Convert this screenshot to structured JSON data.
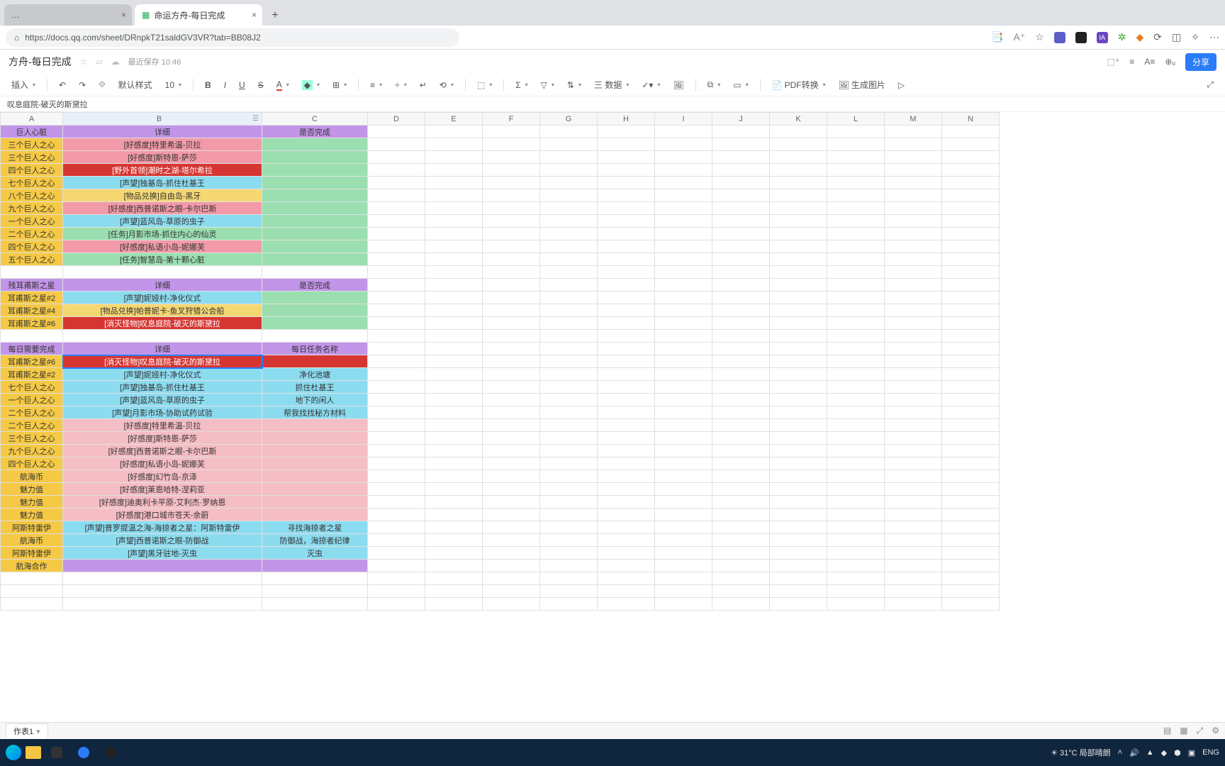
{
  "tabs": {
    "inactive": "…",
    "active": "命运方舟-每日完成"
  },
  "url": "https://docs.qq.com/sheet/DRnpkT21saldGV3VR?tab=BB08J2",
  "doc_title": "方舟-每日完成",
  "save_meta": "最近保存 10:46",
  "share": "分享",
  "toolbar": {
    "insert": "插入",
    "undo": "↶",
    "redo": "↷",
    "paint": "⟐",
    "clear": "默认样式",
    "fontsize": "10",
    "pdf": "PDF转换",
    "genimg": "生成图片"
  },
  "formula": "叹息庭院-破灭的斯黛拉",
  "cols": [
    "A",
    "B",
    "C",
    "D",
    "E",
    "F",
    "G",
    "H",
    "I",
    "J",
    "K",
    "L",
    "M",
    "N"
  ],
  "sheet_tab": "作表1",
  "weather": "31°C  局部晴朗",
  "lang": "ENG",
  "chart_data": null,
  "rows": [
    {
      "a": "巨人心脏",
      "b": "详细",
      "c": "是否完成",
      "cls": [
        "c-purple",
        "c-purple",
        "c-purple"
      ]
    },
    {
      "a": "三个巨人之心",
      "b": "[好感度]特里希温-贝拉",
      "c": "",
      "cls": [
        "c-yellow2",
        "c-pink",
        "c-green"
      ]
    },
    {
      "a": "三个巨人之心",
      "b": "[好感度]斯特恩-萨莎",
      "c": "",
      "cls": [
        "c-yellow2",
        "c-pink",
        "c-green"
      ]
    },
    {
      "a": "四个巨人之心",
      "b": "[野外首领]潮时之湖-塔尔希拉",
      "c": "",
      "cls": [
        "c-yellow2",
        "c-red",
        "c-green"
      ]
    },
    {
      "a": "七个巨人之心",
      "b": "[声望]独基岛-抓住杜基王",
      "c": "",
      "cls": [
        "c-yellow2",
        "c-dblue",
        "c-green"
      ]
    },
    {
      "a": "八个巨人之心",
      "b": "[物品兑换]自由岛-黑牙",
      "c": "",
      "cls": [
        "c-yellow2",
        "c-yellow",
        "c-green"
      ]
    },
    {
      "a": "九个巨人之心",
      "b": "[好感度]西普诺斯之眼-卡尔巴斯",
      "c": "",
      "cls": [
        "c-yellow2",
        "c-pink",
        "c-green"
      ]
    },
    {
      "a": "一个巨人之心",
      "b": "[声望]蓝风岛-草原的虫子",
      "c": "",
      "cls": [
        "c-yellow2",
        "c-dblue",
        "c-green"
      ]
    },
    {
      "a": "二个巨人之心",
      "b": "[任务]月影市场-抓住内心的仙灵",
      "c": "",
      "cls": [
        "c-yellow2",
        "c-green",
        "c-green"
      ]
    },
    {
      "a": "四个巨人之心",
      "b": "[好感度]私语小岛-妮娜芙",
      "c": "",
      "cls": [
        "c-yellow2",
        "c-pink",
        "c-green"
      ]
    },
    {
      "a": "五个巨人之心",
      "b": "[任务]智慧岛-第十颗心脏",
      "c": "",
      "cls": [
        "c-yellow2",
        "c-green",
        "c-green"
      ]
    },
    {
      "a": "",
      "b": "",
      "c": "",
      "cls": [
        "",
        "",
        ""
      ]
    },
    {
      "a": "残耳甫斯之星",
      "b": "详细",
      "c": "是否完成",
      "cls": [
        "c-purple",
        "c-purple",
        "c-purple"
      ]
    },
    {
      "a": "耳甫斯之星#2",
      "b": "[声望]妮娅村-净化仪式",
      "c": "",
      "cls": [
        "c-yellow2",
        "c-dblue",
        "c-green"
      ]
    },
    {
      "a": "耳甫斯之星#4",
      "b": "[物品兑换]帕普妮卡-鱼叉狩猎公会船",
      "c": "",
      "cls": [
        "c-yellow2",
        "c-yellow",
        "c-green"
      ]
    },
    {
      "a": "耳甫斯之星#6",
      "b": "[消灭怪物]叹息庭院-破灭的斯黛拉",
      "c": "",
      "cls": [
        "c-yellow2",
        "c-red",
        "c-green"
      ]
    },
    {
      "a": "",
      "b": "",
      "c": "",
      "cls": [
        "",
        "",
        ""
      ]
    },
    {
      "a": "每日需要完成",
      "b": "详细",
      "c": "每日任务名称",
      "cls": [
        "c-purple",
        "c-purple",
        "c-purple"
      ]
    },
    {
      "a": "耳甫斯之星#6",
      "b": "[消灭怪物]叹息庭院-破灭的斯黛拉",
      "c": "",
      "cls": [
        "c-yellow2",
        "c-red",
        "c-red"
      ],
      "sel": true
    },
    {
      "a": "耳甫斯之星#2",
      "b": "[声望]妮娅村-净化仪式",
      "c": "净化池塘",
      "cls": [
        "c-yellow2",
        "c-dblue",
        "c-dblue"
      ]
    },
    {
      "a": "七个巨人之心",
      "b": "[声望]独基岛-抓住杜基王",
      "c": "抓住杜基王",
      "cls": [
        "c-yellow2",
        "c-dblue",
        "c-dblue"
      ]
    },
    {
      "a": "一个巨人之心",
      "b": "[声望]蓝风岛-草原的虫子",
      "c": "地下的闲人",
      "cls": [
        "c-yellow2",
        "c-dblue",
        "c-dblue"
      ]
    },
    {
      "a": "二个巨人之心",
      "b": "[声望]月影市场-协助试药试验",
      "c": "帮我找找秘方材料",
      "cls": [
        "c-yellow2",
        "c-dblue",
        "c-dblue"
      ]
    },
    {
      "a": "二个巨人之心",
      "b": "[好感度]特里希温-贝拉",
      "c": "",
      "cls": [
        "c-yellow2",
        "c-lpink",
        "c-lpink"
      ]
    },
    {
      "a": "三个巨人之心",
      "b": "[好感度]斯特恩-萨莎",
      "c": "",
      "cls": [
        "c-yellow2",
        "c-lpink",
        "c-lpink"
      ]
    },
    {
      "a": "九个巨人之心",
      "b": "[好感度]西普诺斯之眼-卡尔巴斯",
      "c": "",
      "cls": [
        "c-yellow2",
        "c-lpink",
        "c-lpink"
      ]
    },
    {
      "a": "四个巨人之心",
      "b": "[好感度]私语小岛-妮娜芙",
      "c": "",
      "cls": [
        "c-yellow2",
        "c-lpink",
        "c-lpink"
      ]
    },
    {
      "a": "航海币",
      "b": "[好感度]幻竹岛-京泽",
      "c": "",
      "cls": [
        "c-yellow2",
        "c-lpink",
        "c-lpink"
      ]
    },
    {
      "a": "魅力值",
      "b": "[好感度]莱恩哈特-涅莉亚",
      "c": "",
      "cls": [
        "c-yellow2",
        "c-lpink",
        "c-lpink"
      ]
    },
    {
      "a": "魅力值",
      "b": "[好感度]迪奥利卡平原-艾利杰·罗纳恩",
      "c": "",
      "cls": [
        "c-yellow2",
        "c-lpink",
        "c-lpink"
      ]
    },
    {
      "a": "魅力值",
      "b": "[好感度]港口城市苍天-余蔚",
      "c": "",
      "cls": [
        "c-yellow2",
        "c-lpink",
        "c-lpink"
      ]
    },
    {
      "a": "阿斯特雷伊",
      "b": "[声望]普罗提温之海-海掠者之星：阿斯特雷伊",
      "c": "寻找海掠者之星",
      "cls": [
        "c-yellow2",
        "c-dblue",
        "c-dblue"
      ]
    },
    {
      "a": "航海币",
      "b": "[声望]西普诺斯之眼-防御战",
      "c": "防御战，海掠者纪律",
      "cls": [
        "c-yellow2",
        "c-dblue",
        "c-dblue"
      ]
    },
    {
      "a": "阿斯特雷伊",
      "b": "[声望]黑牙驻地-灭虫",
      "c": "灭虫",
      "cls": [
        "c-yellow2",
        "c-dblue",
        "c-dblue"
      ]
    },
    {
      "a": "航海合作",
      "b": "",
      "c": "",
      "cls": [
        "c-yellow2",
        "c-purple",
        "c-purple"
      ]
    },
    {
      "a": "",
      "b": "",
      "c": "",
      "cls": [
        "",
        "",
        ""
      ]
    },
    {
      "a": "",
      "b": "",
      "c": "",
      "cls": [
        "",
        "",
        ""
      ]
    },
    {
      "a": "",
      "b": "",
      "c": "",
      "cls": [
        "",
        "",
        ""
      ]
    }
  ]
}
